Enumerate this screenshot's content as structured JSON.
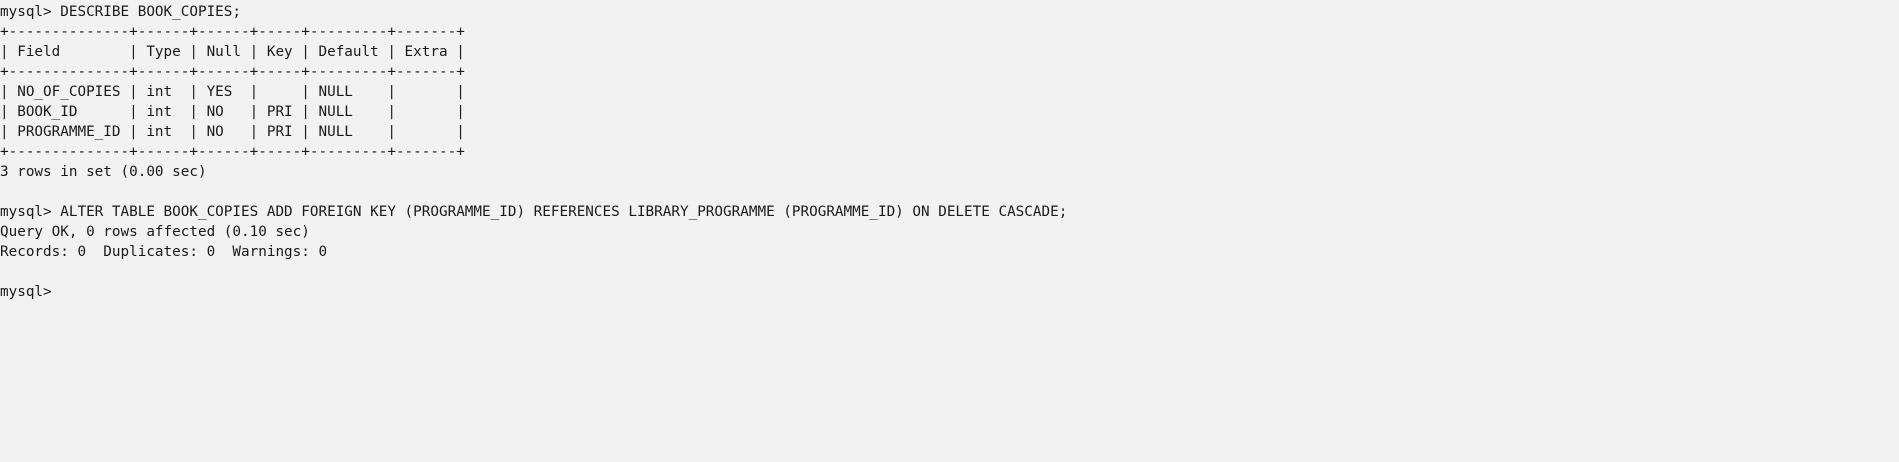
{
  "terminal": {
    "lines": [
      "mysql> DESCRIBE BOOK_COPIES;",
      "+--------------+------+------+-----+---------+-------+",
      "| Field        | Type | Null | Key | Default | Extra |",
      "+--------------+------+------+-----+---------+-------+",
      "| NO_OF_COPIES | int  | YES  |     | NULL    |       |",
      "| BOOK_ID      | int  | NO   | PRI | NULL    |       |",
      "| PROGRAMME_ID | int  | NO   | PRI | NULL    |       |",
      "+--------------+------+------+-----+---------+-------+",
      "3 rows in set (0.00 sec)",
      "",
      "mysql> ALTER TABLE BOOK_COPIES ADD FOREIGN KEY (PROGRAMME_ID) REFERENCES LIBRARY_PROGRAMME (PROGRAMME_ID) ON DELETE CASCADE;",
      "Query OK, 0 rows affected (0.10 sec)",
      "Records: 0  Duplicates: 0  Warnings: 0",
      "",
      "mysql>"
    ]
  }
}
